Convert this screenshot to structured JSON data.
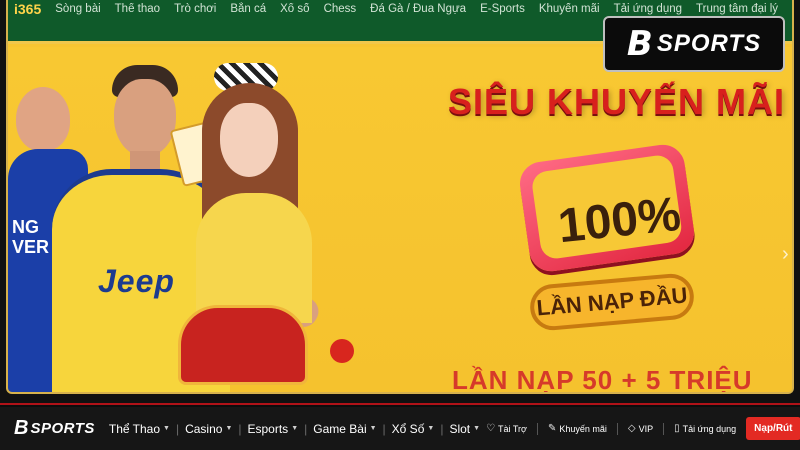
{
  "screenshot": {
    "site_logo": "i365",
    "site_menu": [
      "Sòng bài",
      "Thể thao",
      "Trò chơi",
      "Bắn cá",
      "Xổ số",
      "Chess",
      "Đá Gà / Đua Ngựa",
      "E-Sports",
      "Khuyến mãi",
      "Tải ứng dụng",
      "Trung tâm đại lý"
    ],
    "promo": {
      "title": "SIÊU KHUYẾN MÃI",
      "percent": "100%",
      "subtitle": "LẦN NẠP ĐẦU",
      "bottom_line": "LẦN NẠP 50 + 5 TRIỆU"
    },
    "jersey_text": "Jeep",
    "left_player_text": "NG\nVER",
    "carousel_arrow": "›"
  },
  "brand": {
    "mark": "B",
    "text": "SPORTS"
  },
  "navbar": {
    "logo_mark": "B",
    "logo_text": "SPORTS",
    "items": [
      {
        "label": "Thể Thao"
      },
      {
        "label": "Casino"
      },
      {
        "label": "Esports"
      },
      {
        "label": "Game Bài"
      },
      {
        "label": "Xổ Số"
      },
      {
        "label": "Slot"
      }
    ],
    "links": [
      {
        "icon": "sponsor-icon",
        "glyph": "♡",
        "label": "Tài Trợ"
      },
      {
        "icon": "promotion-icon",
        "glyph": "✎",
        "label": "Khuyến mãi"
      },
      {
        "icon": "vip-icon",
        "glyph": "◇",
        "label": "VIP"
      },
      {
        "icon": "mobile-app-icon",
        "glyph": "▯",
        "label": "Tải ứng dụng"
      }
    ],
    "cta_label": "Nạp/Rút"
  },
  "colors": {
    "banner_bg": "#f7c531",
    "site_nav_bg": "#0f5a2a",
    "navbar_bg": "#161616",
    "cta_bg": "#e32a23",
    "accent_red": "#d8201d"
  }
}
